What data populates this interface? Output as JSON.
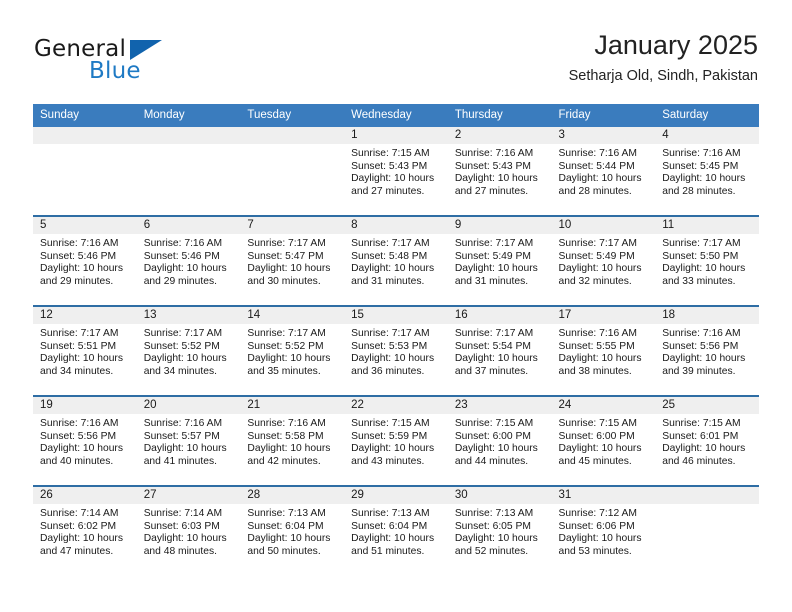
{
  "brand": {
    "name_part1": "General",
    "name_part2": "Blue",
    "accent_color": "#1f7ac4",
    "flag_color": "#1163ad"
  },
  "header": {
    "title": "January 2025",
    "subtitle": "Setharja Old, Sindh, Pakistan"
  },
  "calendar": {
    "header_bg": "#3a7cbe",
    "row_divider_color": "#2e6da4",
    "daynum_band_color": "#efefef",
    "weekdays": [
      "Sunday",
      "Monday",
      "Tuesday",
      "Wednesday",
      "Thursday",
      "Friday",
      "Saturday"
    ],
    "labels": {
      "sunrise": "Sunrise:",
      "sunset": "Sunset:",
      "daylight": "Daylight:"
    },
    "weeks": [
      [
        {
          "day": ""
        },
        {
          "day": ""
        },
        {
          "day": ""
        },
        {
          "day": "1",
          "sunrise": "Sunrise: 7:15 AM",
          "sunset": "Sunset: 5:43 PM",
          "daylight_line1": "Daylight: 10 hours",
          "daylight_line2": "and 27 minutes."
        },
        {
          "day": "2",
          "sunrise": "Sunrise: 7:16 AM",
          "sunset": "Sunset: 5:43 PM",
          "daylight_line1": "Daylight: 10 hours",
          "daylight_line2": "and 27 minutes."
        },
        {
          "day": "3",
          "sunrise": "Sunrise: 7:16 AM",
          "sunset": "Sunset: 5:44 PM",
          "daylight_line1": "Daylight: 10 hours",
          "daylight_line2": "and 28 minutes."
        },
        {
          "day": "4",
          "sunrise": "Sunrise: 7:16 AM",
          "sunset": "Sunset: 5:45 PM",
          "daylight_line1": "Daylight: 10 hours",
          "daylight_line2": "and 28 minutes."
        }
      ],
      [
        {
          "day": "5",
          "sunrise": "Sunrise: 7:16 AM",
          "sunset": "Sunset: 5:46 PM",
          "daylight_line1": "Daylight: 10 hours",
          "daylight_line2": "and 29 minutes."
        },
        {
          "day": "6",
          "sunrise": "Sunrise: 7:16 AM",
          "sunset": "Sunset: 5:46 PM",
          "daylight_line1": "Daylight: 10 hours",
          "daylight_line2": "and 29 minutes."
        },
        {
          "day": "7",
          "sunrise": "Sunrise: 7:17 AM",
          "sunset": "Sunset: 5:47 PM",
          "daylight_line1": "Daylight: 10 hours",
          "daylight_line2": "and 30 minutes."
        },
        {
          "day": "8",
          "sunrise": "Sunrise: 7:17 AM",
          "sunset": "Sunset: 5:48 PM",
          "daylight_line1": "Daylight: 10 hours",
          "daylight_line2": "and 31 minutes."
        },
        {
          "day": "9",
          "sunrise": "Sunrise: 7:17 AM",
          "sunset": "Sunset: 5:49 PM",
          "daylight_line1": "Daylight: 10 hours",
          "daylight_line2": "and 31 minutes."
        },
        {
          "day": "10",
          "sunrise": "Sunrise: 7:17 AM",
          "sunset": "Sunset: 5:49 PM",
          "daylight_line1": "Daylight: 10 hours",
          "daylight_line2": "and 32 minutes."
        },
        {
          "day": "11",
          "sunrise": "Sunrise: 7:17 AM",
          "sunset": "Sunset: 5:50 PM",
          "daylight_line1": "Daylight: 10 hours",
          "daylight_line2": "and 33 minutes."
        }
      ],
      [
        {
          "day": "12",
          "sunrise": "Sunrise: 7:17 AM",
          "sunset": "Sunset: 5:51 PM",
          "daylight_line1": "Daylight: 10 hours",
          "daylight_line2": "and 34 minutes."
        },
        {
          "day": "13",
          "sunrise": "Sunrise: 7:17 AM",
          "sunset": "Sunset: 5:52 PM",
          "daylight_line1": "Daylight: 10 hours",
          "daylight_line2": "and 34 minutes."
        },
        {
          "day": "14",
          "sunrise": "Sunrise: 7:17 AM",
          "sunset": "Sunset: 5:52 PM",
          "daylight_line1": "Daylight: 10 hours",
          "daylight_line2": "and 35 minutes."
        },
        {
          "day": "15",
          "sunrise": "Sunrise: 7:17 AM",
          "sunset": "Sunset: 5:53 PM",
          "daylight_line1": "Daylight: 10 hours",
          "daylight_line2": "and 36 minutes."
        },
        {
          "day": "16",
          "sunrise": "Sunrise: 7:17 AM",
          "sunset": "Sunset: 5:54 PM",
          "daylight_line1": "Daylight: 10 hours",
          "daylight_line2": "and 37 minutes."
        },
        {
          "day": "17",
          "sunrise": "Sunrise: 7:16 AM",
          "sunset": "Sunset: 5:55 PM",
          "daylight_line1": "Daylight: 10 hours",
          "daylight_line2": "and 38 minutes."
        },
        {
          "day": "18",
          "sunrise": "Sunrise: 7:16 AM",
          "sunset": "Sunset: 5:56 PM",
          "daylight_line1": "Daylight: 10 hours",
          "daylight_line2": "and 39 minutes."
        }
      ],
      [
        {
          "day": "19",
          "sunrise": "Sunrise: 7:16 AM",
          "sunset": "Sunset: 5:56 PM",
          "daylight_line1": "Daylight: 10 hours",
          "daylight_line2": "and 40 minutes."
        },
        {
          "day": "20",
          "sunrise": "Sunrise: 7:16 AM",
          "sunset": "Sunset: 5:57 PM",
          "daylight_line1": "Daylight: 10 hours",
          "daylight_line2": "and 41 minutes."
        },
        {
          "day": "21",
          "sunrise": "Sunrise: 7:16 AM",
          "sunset": "Sunset: 5:58 PM",
          "daylight_line1": "Daylight: 10 hours",
          "daylight_line2": "and 42 minutes."
        },
        {
          "day": "22",
          "sunrise": "Sunrise: 7:15 AM",
          "sunset": "Sunset: 5:59 PM",
          "daylight_line1": "Daylight: 10 hours",
          "daylight_line2": "and 43 minutes."
        },
        {
          "day": "23",
          "sunrise": "Sunrise: 7:15 AM",
          "sunset": "Sunset: 6:00 PM",
          "daylight_line1": "Daylight: 10 hours",
          "daylight_line2": "and 44 minutes."
        },
        {
          "day": "24",
          "sunrise": "Sunrise: 7:15 AM",
          "sunset": "Sunset: 6:00 PM",
          "daylight_line1": "Daylight: 10 hours",
          "daylight_line2": "and 45 minutes."
        },
        {
          "day": "25",
          "sunrise": "Sunrise: 7:15 AM",
          "sunset": "Sunset: 6:01 PM",
          "daylight_line1": "Daylight: 10 hours",
          "daylight_line2": "and 46 minutes."
        }
      ],
      [
        {
          "day": "26",
          "sunrise": "Sunrise: 7:14 AM",
          "sunset": "Sunset: 6:02 PM",
          "daylight_line1": "Daylight: 10 hours",
          "daylight_line2": "and 47 minutes."
        },
        {
          "day": "27",
          "sunrise": "Sunrise: 7:14 AM",
          "sunset": "Sunset: 6:03 PM",
          "daylight_line1": "Daylight: 10 hours",
          "daylight_line2": "and 48 minutes."
        },
        {
          "day": "28",
          "sunrise": "Sunrise: 7:13 AM",
          "sunset": "Sunset: 6:04 PM",
          "daylight_line1": "Daylight: 10 hours",
          "daylight_line2": "and 50 minutes."
        },
        {
          "day": "29",
          "sunrise": "Sunrise: 7:13 AM",
          "sunset": "Sunset: 6:04 PM",
          "daylight_line1": "Daylight: 10 hours",
          "daylight_line2": "and 51 minutes."
        },
        {
          "day": "30",
          "sunrise": "Sunrise: 7:13 AM",
          "sunset": "Sunset: 6:05 PM",
          "daylight_line1": "Daylight: 10 hours",
          "daylight_line2": "and 52 minutes."
        },
        {
          "day": "31",
          "sunrise": "Sunrise: 7:12 AM",
          "sunset": "Sunset: 6:06 PM",
          "daylight_line1": "Daylight: 10 hours",
          "daylight_line2": "and 53 minutes."
        },
        {
          "day": ""
        }
      ]
    ]
  }
}
